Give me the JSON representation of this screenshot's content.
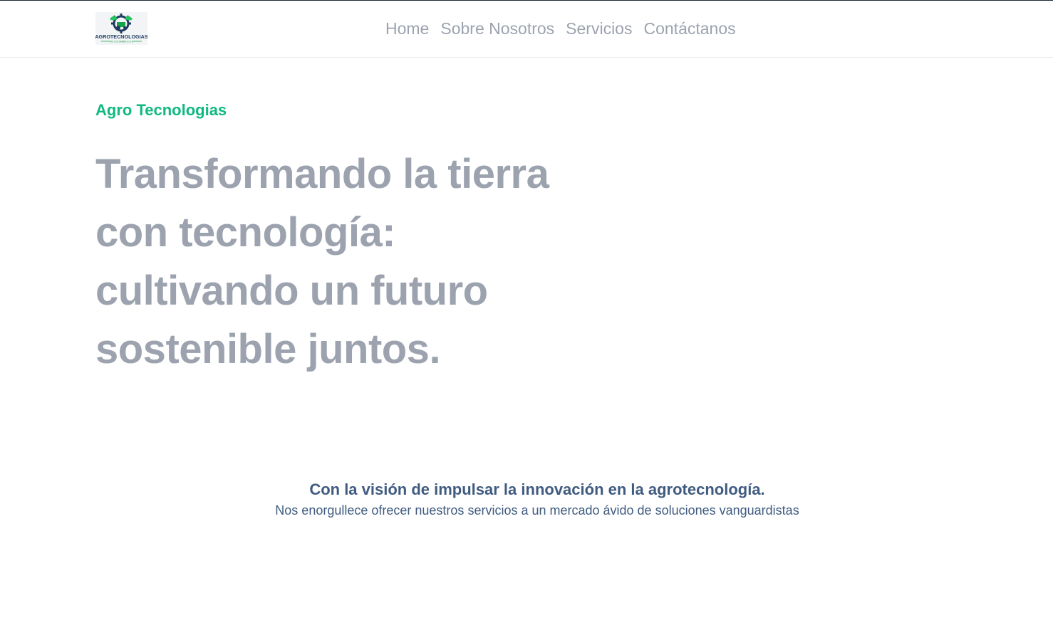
{
  "header": {
    "logo_text": "AGROTECNOLOGIAS",
    "logo_subtext": "DE COLOMBIA S.A.S",
    "nav": [
      {
        "label": "Home"
      },
      {
        "label": "Sobre Nosotros"
      },
      {
        "label": "Servicios"
      },
      {
        "label": "Contáctanos"
      }
    ]
  },
  "hero": {
    "eyebrow": "Agro Tecnologias",
    "title": "Transformando la tierra con tecnología: cultivando un futuro sostenible juntos."
  },
  "vision": {
    "title": "Con la visión de impulsar la innovación en la agrotecnología.",
    "subtitle": "Nos enorgullece ofrecer nuestros servicios a un mercado ávido de soluciones vanguardistas"
  },
  "colors": {
    "accent_green": "#10b981",
    "nav_gray": "#9ca3af",
    "heading_gray": "#9ca3af",
    "vision_blue": "#3f5b80"
  },
  "icons": {
    "logo": "gear-leaf-tractor-logo"
  }
}
